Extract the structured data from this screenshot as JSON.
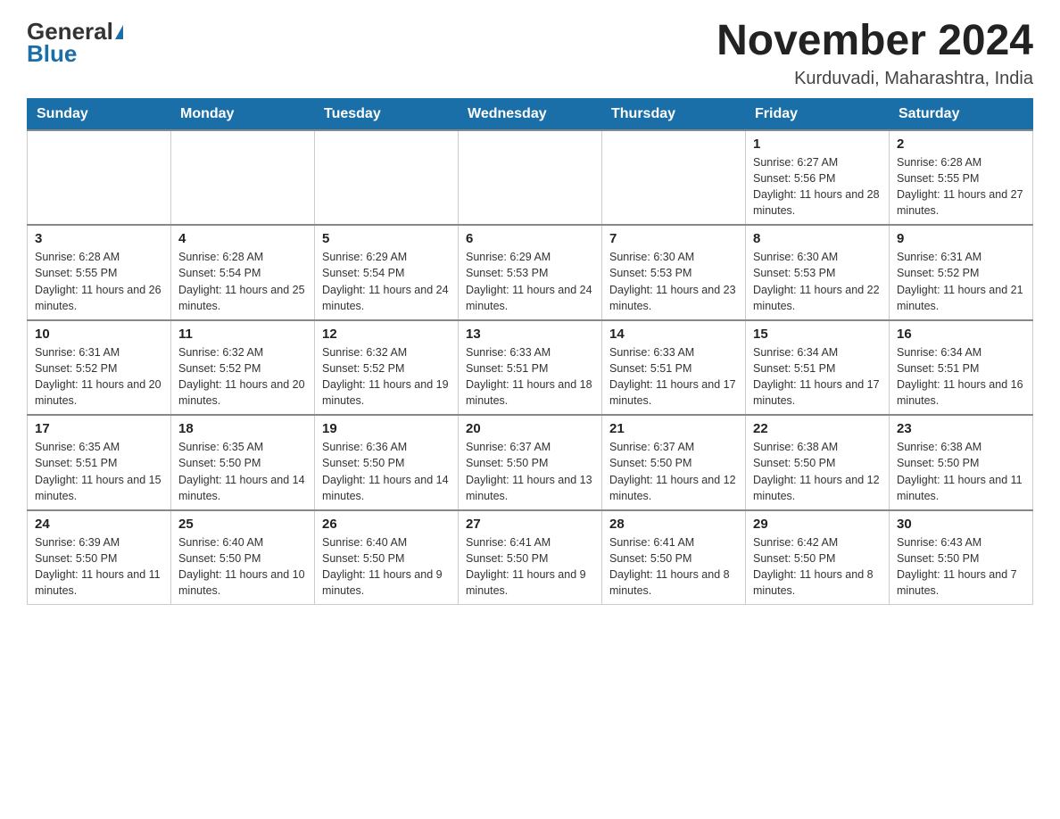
{
  "header": {
    "logo_general": "General",
    "logo_blue": "Blue",
    "title": "November 2024",
    "subtitle": "Kurduvadi, Maharashtra, India"
  },
  "days_of_week": [
    "Sunday",
    "Monday",
    "Tuesday",
    "Wednesday",
    "Thursday",
    "Friday",
    "Saturday"
  ],
  "weeks": [
    [
      {
        "num": "",
        "sunrise": "",
        "sunset": "",
        "daylight": ""
      },
      {
        "num": "",
        "sunrise": "",
        "sunset": "",
        "daylight": ""
      },
      {
        "num": "",
        "sunrise": "",
        "sunset": "",
        "daylight": ""
      },
      {
        "num": "",
        "sunrise": "",
        "sunset": "",
        "daylight": ""
      },
      {
        "num": "",
        "sunrise": "",
        "sunset": "",
        "daylight": ""
      },
      {
        "num": "1",
        "sunrise": "Sunrise: 6:27 AM",
        "sunset": "Sunset: 5:56 PM",
        "daylight": "Daylight: 11 hours and 28 minutes."
      },
      {
        "num": "2",
        "sunrise": "Sunrise: 6:28 AM",
        "sunset": "Sunset: 5:55 PM",
        "daylight": "Daylight: 11 hours and 27 minutes."
      }
    ],
    [
      {
        "num": "3",
        "sunrise": "Sunrise: 6:28 AM",
        "sunset": "Sunset: 5:55 PM",
        "daylight": "Daylight: 11 hours and 26 minutes."
      },
      {
        "num": "4",
        "sunrise": "Sunrise: 6:28 AM",
        "sunset": "Sunset: 5:54 PM",
        "daylight": "Daylight: 11 hours and 25 minutes."
      },
      {
        "num": "5",
        "sunrise": "Sunrise: 6:29 AM",
        "sunset": "Sunset: 5:54 PM",
        "daylight": "Daylight: 11 hours and 24 minutes."
      },
      {
        "num": "6",
        "sunrise": "Sunrise: 6:29 AM",
        "sunset": "Sunset: 5:53 PM",
        "daylight": "Daylight: 11 hours and 24 minutes."
      },
      {
        "num": "7",
        "sunrise": "Sunrise: 6:30 AM",
        "sunset": "Sunset: 5:53 PM",
        "daylight": "Daylight: 11 hours and 23 minutes."
      },
      {
        "num": "8",
        "sunrise": "Sunrise: 6:30 AM",
        "sunset": "Sunset: 5:53 PM",
        "daylight": "Daylight: 11 hours and 22 minutes."
      },
      {
        "num": "9",
        "sunrise": "Sunrise: 6:31 AM",
        "sunset": "Sunset: 5:52 PM",
        "daylight": "Daylight: 11 hours and 21 minutes."
      }
    ],
    [
      {
        "num": "10",
        "sunrise": "Sunrise: 6:31 AM",
        "sunset": "Sunset: 5:52 PM",
        "daylight": "Daylight: 11 hours and 20 minutes."
      },
      {
        "num": "11",
        "sunrise": "Sunrise: 6:32 AM",
        "sunset": "Sunset: 5:52 PM",
        "daylight": "Daylight: 11 hours and 20 minutes."
      },
      {
        "num": "12",
        "sunrise": "Sunrise: 6:32 AM",
        "sunset": "Sunset: 5:52 PM",
        "daylight": "Daylight: 11 hours and 19 minutes."
      },
      {
        "num": "13",
        "sunrise": "Sunrise: 6:33 AM",
        "sunset": "Sunset: 5:51 PM",
        "daylight": "Daylight: 11 hours and 18 minutes."
      },
      {
        "num": "14",
        "sunrise": "Sunrise: 6:33 AM",
        "sunset": "Sunset: 5:51 PM",
        "daylight": "Daylight: 11 hours and 17 minutes."
      },
      {
        "num": "15",
        "sunrise": "Sunrise: 6:34 AM",
        "sunset": "Sunset: 5:51 PM",
        "daylight": "Daylight: 11 hours and 17 minutes."
      },
      {
        "num": "16",
        "sunrise": "Sunrise: 6:34 AM",
        "sunset": "Sunset: 5:51 PM",
        "daylight": "Daylight: 11 hours and 16 minutes."
      }
    ],
    [
      {
        "num": "17",
        "sunrise": "Sunrise: 6:35 AM",
        "sunset": "Sunset: 5:51 PM",
        "daylight": "Daylight: 11 hours and 15 minutes."
      },
      {
        "num": "18",
        "sunrise": "Sunrise: 6:35 AM",
        "sunset": "Sunset: 5:50 PM",
        "daylight": "Daylight: 11 hours and 14 minutes."
      },
      {
        "num": "19",
        "sunrise": "Sunrise: 6:36 AM",
        "sunset": "Sunset: 5:50 PM",
        "daylight": "Daylight: 11 hours and 14 minutes."
      },
      {
        "num": "20",
        "sunrise": "Sunrise: 6:37 AM",
        "sunset": "Sunset: 5:50 PM",
        "daylight": "Daylight: 11 hours and 13 minutes."
      },
      {
        "num": "21",
        "sunrise": "Sunrise: 6:37 AM",
        "sunset": "Sunset: 5:50 PM",
        "daylight": "Daylight: 11 hours and 12 minutes."
      },
      {
        "num": "22",
        "sunrise": "Sunrise: 6:38 AM",
        "sunset": "Sunset: 5:50 PM",
        "daylight": "Daylight: 11 hours and 12 minutes."
      },
      {
        "num": "23",
        "sunrise": "Sunrise: 6:38 AM",
        "sunset": "Sunset: 5:50 PM",
        "daylight": "Daylight: 11 hours and 11 minutes."
      }
    ],
    [
      {
        "num": "24",
        "sunrise": "Sunrise: 6:39 AM",
        "sunset": "Sunset: 5:50 PM",
        "daylight": "Daylight: 11 hours and 11 minutes."
      },
      {
        "num": "25",
        "sunrise": "Sunrise: 6:40 AM",
        "sunset": "Sunset: 5:50 PM",
        "daylight": "Daylight: 11 hours and 10 minutes."
      },
      {
        "num": "26",
        "sunrise": "Sunrise: 6:40 AM",
        "sunset": "Sunset: 5:50 PM",
        "daylight": "Daylight: 11 hours and 9 minutes."
      },
      {
        "num": "27",
        "sunrise": "Sunrise: 6:41 AM",
        "sunset": "Sunset: 5:50 PM",
        "daylight": "Daylight: 11 hours and 9 minutes."
      },
      {
        "num": "28",
        "sunrise": "Sunrise: 6:41 AM",
        "sunset": "Sunset: 5:50 PM",
        "daylight": "Daylight: 11 hours and 8 minutes."
      },
      {
        "num": "29",
        "sunrise": "Sunrise: 6:42 AM",
        "sunset": "Sunset: 5:50 PM",
        "daylight": "Daylight: 11 hours and 8 minutes."
      },
      {
        "num": "30",
        "sunrise": "Sunrise: 6:43 AM",
        "sunset": "Sunset: 5:50 PM",
        "daylight": "Daylight: 11 hours and 7 minutes."
      }
    ]
  ]
}
